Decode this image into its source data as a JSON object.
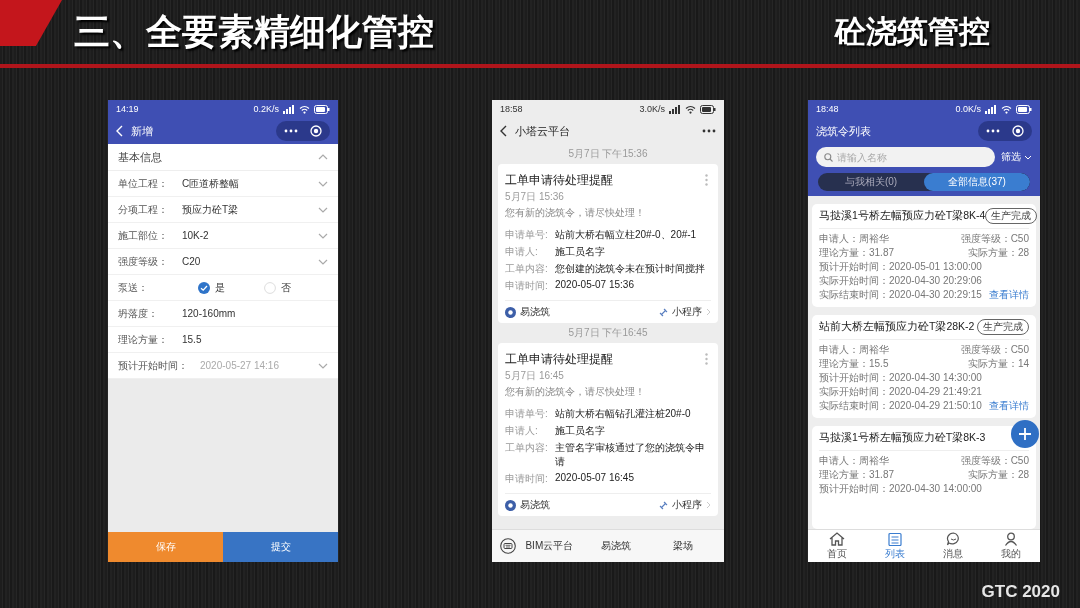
{
  "slide": {
    "title": "三、全要素精细化管控",
    "subtitle": "砼浇筑管控",
    "footer": "GTC 2020"
  },
  "phone_1": {
    "status_bar": {
      "time": "14:19",
      "speed": "0.2K/s"
    },
    "nav": {
      "title": "新增"
    },
    "section": {
      "title": "基本信息",
      "expanded": true
    },
    "fields": [
      {
        "kind": "select",
        "label": "单位工程：",
        "value": "C匝道桥整幅"
      },
      {
        "kind": "select",
        "label": "分项工程：",
        "value": "预应力砼T梁"
      },
      {
        "kind": "select",
        "label": "施工部位：",
        "value": "10K-2"
      },
      {
        "kind": "select",
        "label": "强度等级：",
        "value": "C20"
      },
      {
        "kind": "radio",
        "label": "泵送：",
        "options": [
          {
            "label": "是",
            "selected": true
          },
          {
            "label": "否",
            "selected": false
          }
        ]
      },
      {
        "kind": "text",
        "label": "坍落度：",
        "value": "120-160mm"
      },
      {
        "kind": "text",
        "label": "理论方量：",
        "value": "15.5"
      },
      {
        "kind": "picker",
        "label": "预计开始时间：",
        "placeholder": "2020-05-27 14:16"
      }
    ],
    "buttons": [
      {
        "label": "保存",
        "kind": "secondary"
      },
      {
        "label": "提交",
        "kind": "primary"
      }
    ]
  },
  "phone_2": {
    "status_bar": {
      "time": "18:58",
      "speed": "3.0K/s"
    },
    "nav": {
      "title": "小塔云平台"
    },
    "messages": [
      {
        "timestamp": "5月7日 下午15:36",
        "title": "工单申请待处理提醒",
        "date": "5月7日 15:36",
        "summary": "您有新的浇筑令，请尽快处理！",
        "rows": [
          {
            "label": "申请单号:",
            "value": "站前大桥右幅立柱20#-0、20#-1"
          },
          {
            "label": "申请人:",
            "value": "施工员名字"
          },
          {
            "label": "工单内容:",
            "value": "您创建的浇筑令未在预计时间搅拌"
          },
          {
            "label": "申请时间:",
            "value": "2020-05-07 15:36"
          }
        ],
        "source": "易浇筑",
        "link": "小程序"
      },
      {
        "timestamp": "5月7日 下午16:45",
        "title": "工单申请待处理提醒",
        "date": "5月7日 16:45",
        "summary": "您有新的浇筑令，请尽快处理！",
        "rows": [
          {
            "label": "申请单号:",
            "value": "站前大桥右幅钻孔灌注桩20#-0"
          },
          {
            "label": "申请人:",
            "value": "施工员名字"
          },
          {
            "label": "工单内容:",
            "value": "主管名字审核通过了您的浇筑令申请"
          },
          {
            "label": "申请时间:",
            "value": "2020-05-07 16:45"
          }
        ],
        "source": "易浇筑",
        "link": "小程序"
      }
    ],
    "menu": [
      "BIM云平台",
      "易浇筑",
      "梁场"
    ]
  },
  "phone_3": {
    "status_bar": {
      "time": "18:48",
      "speed": "0.0K/s"
    },
    "nav": {
      "title": "浇筑令列表"
    },
    "search": {
      "placeholder": "请输入名称"
    },
    "filter": "筛选",
    "tabs": [
      {
        "label": "与我相关(0)",
        "selected": false
      },
      {
        "label": "全部信息(37)",
        "selected": true
      }
    ],
    "orders": [
      {
        "title": "马挞溪1号桥左幅预应力砼T梁8K-4",
        "status": "生产完成",
        "applicant": "申请人：周裕华",
        "grade": "强度等级：C50",
        "planned": "理论方量：31.87",
        "actual": "实际方量：28",
        "times": [
          "预计开始时间：2020-05-01 13:00:00",
          "实际开始时间：2020-04-30 20:29:06",
          "实际结束时间：2020-04-30 20:29:15"
        ],
        "link": "查看详情"
      },
      {
        "title": "站前大桥左幅预应力砼T梁28K-2",
        "status": "生产完成",
        "applicant": "申请人：周裕华",
        "grade": "强度等级：C50",
        "planned": "理论方量：15.5",
        "actual": "实际方量：14",
        "times": [
          "预计开始时间：2020-04-30 14:30:00",
          "实际开始时间：2020-04-29 21:49:21",
          "实际结束时间：2020-04-29 21:50:10"
        ],
        "link": "查看详情"
      },
      {
        "title": "马挞溪1号桥左幅预应力砼T梁8K-3",
        "applicant": "申请人：周裕华",
        "grade": "强度等级：C50",
        "planned": "理论方量：31.87",
        "actual": "实际方量：28",
        "times": [
          "预计开始时间：2020-04-30 14:00:00"
        ]
      }
    ],
    "tab_bar": [
      {
        "label": "首页",
        "selected": false
      },
      {
        "label": "列表",
        "selected": true
      },
      {
        "label": "消息",
        "selected": false
      },
      {
        "label": "我的",
        "selected": false
      }
    ]
  }
}
